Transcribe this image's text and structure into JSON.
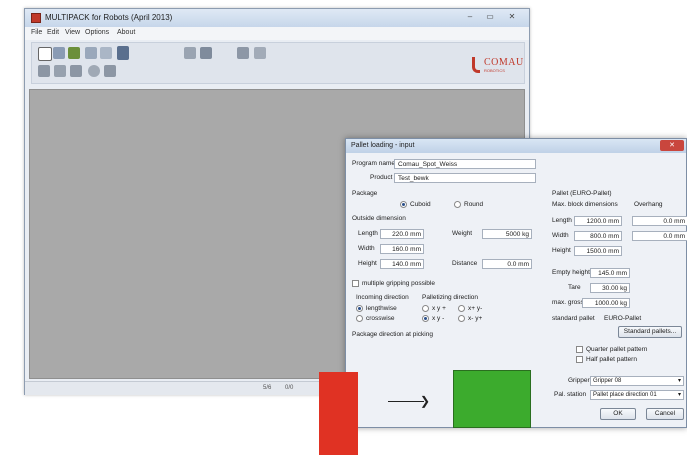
{
  "main_window": {
    "title": "MULTIPACK for Robots (April 2013)",
    "controls": [
      "–",
      "▭",
      "✕"
    ],
    "menu": [
      "File",
      "Edit",
      "View",
      "Options",
      "About"
    ],
    "logo_text": "COMAU",
    "logo_sub": "ROBOTICS",
    "status": [
      "5/6",
      "0/0"
    ]
  },
  "dialog": {
    "title": "Pallet loading - input",
    "close_label": "✕",
    "program_name_label": "Program name",
    "program_name_value": "Comau_Spot_Weiss",
    "product_label": "Product",
    "product_value": "Test_bewk",
    "package": {
      "header": "Package",
      "cuboid_label": "Cuboid",
      "round_label": "Round",
      "outside_dimensions": "Outside dimension",
      "length_label": "Length",
      "length_value": "220.0 mm",
      "width_label": "Width",
      "width_value": "160.0 mm",
      "height_label": "Height",
      "height_value": "140.0 mm",
      "weight_label": "Weight",
      "weight_value": "5000 kg",
      "distance_label": "Distance",
      "distance_value": "0.0 mm"
    },
    "multiple_gripping_label": "multiple gripping possible",
    "incoming_direction": {
      "header": "Incoming direction",
      "options": [
        "lengthwise",
        "crosswise"
      ]
    },
    "palletizing_direction": {
      "header": "Palletizing direction",
      "options": [
        "x y +",
        "x y -",
        "x+ y-",
        "x- y+"
      ]
    },
    "package_direction_label": "Package direction at picking",
    "pallet": {
      "header": "Pallet (EURO-Pallet)",
      "max_dims_label": "Max. block dimensions",
      "overhang_label": "Overhang",
      "length_label": "Length",
      "length_value": "1200.0 mm",
      "width_label": "Width",
      "width_value": "800.0 mm",
      "height_label": "Height",
      "height_value": "1500.0 mm",
      "overhang_length": "0.0 mm",
      "overhang_width": "0.0 mm",
      "empty_height_label": "Empty height",
      "empty_height_value": "145.0 mm",
      "tare_label": "Tare",
      "tare_value": "30.00 kg",
      "max_gross_label": "max. gross",
      "max_gross_value": "1000.00 kg",
      "standard_pallet_label": "standard pallet",
      "standard_pallet_value": "EURO-Pallet",
      "standard_pallets_button": "Standard pallets...",
      "quarter_pallet_label": "Quarter pallet pattern",
      "half_pallet_label": "Half pallet pattern",
      "gripper_label": "Gripper",
      "gripper_value": "Gripper 08",
      "pal_station_label": "Pal. station",
      "pal_station_value": "Pallet place direction 01"
    },
    "ok_label": "OK",
    "cancel_label": "Cancel"
  },
  "colors": {
    "accent_red": "#e03223",
    "package_green": "#3cab2d",
    "workspace_gray": "#a9a9a9"
  }
}
